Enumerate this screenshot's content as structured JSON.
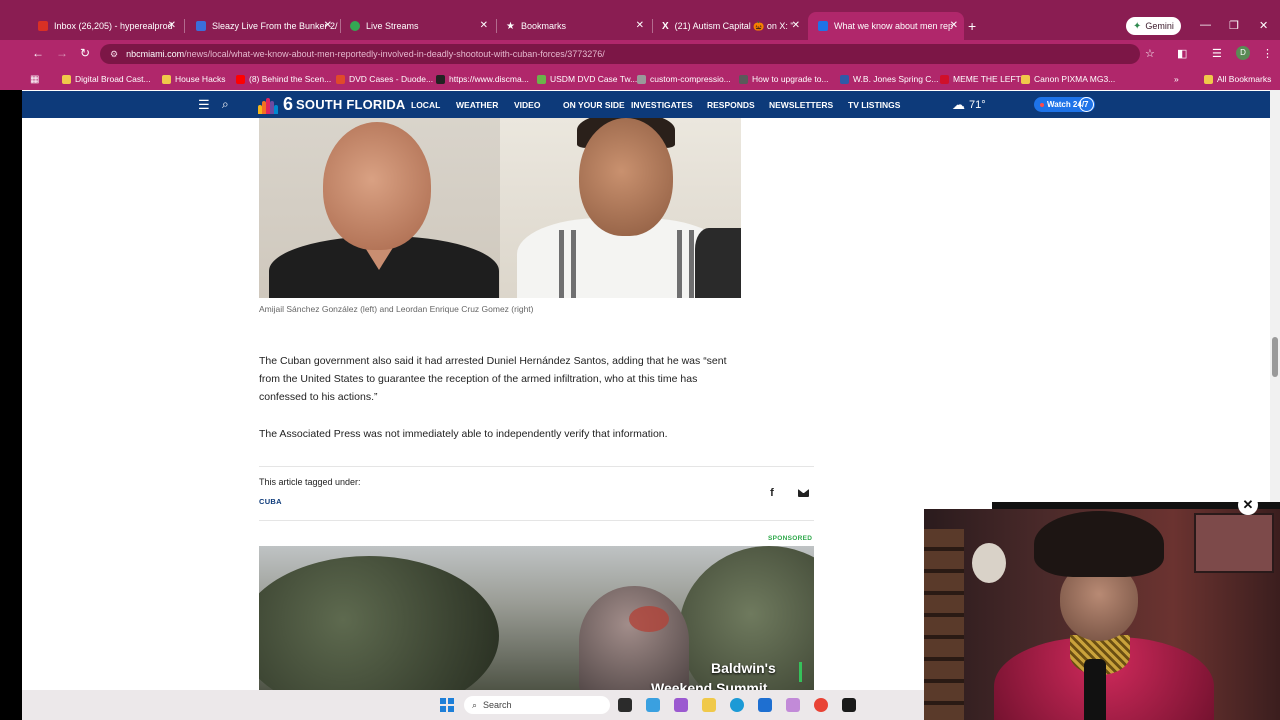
{
  "browser": {
    "tabs": [
      {
        "label": "Inbox (26,205) - hyperealprod",
        "color": "#d93025"
      },
      {
        "label": "Sleazy Live From the Bunker 2/",
        "color": "#3b6fd9"
      },
      {
        "label": "Live Streams",
        "color": "#34a853"
      },
      {
        "label": "Bookmarks",
        "color": "#ffffff"
      },
      {
        "label": "(21) Autism Capital 🎃 on X: \"",
        "color": "#000000"
      },
      {
        "label": "What we know about men rep",
        "color": "#1e73e8"
      }
    ],
    "new_tab": "+",
    "gemini": "Gemini",
    "url_host": "nbcmiami.com",
    "url_path": "/news/local/what-we-know-about-men-reportedly-involved-in-deadly-shootout-with-cuban-forces/3773276/",
    "profile_initial": "D",
    "bookmarks": [
      {
        "label": "Digital Broad Cast...",
        "color": "#f0c94a"
      },
      {
        "label": "House Hacks",
        "color": "#f0c94a"
      },
      {
        "label": "(8) Behind the Scen...",
        "color": "#ff0000"
      },
      {
        "label": "DVD Cases - Duode...",
        "color": "#e04a2a"
      },
      {
        "label": "https://www.discma...",
        "color": "#222222"
      },
      {
        "label": "USDM DVD Case Tw...",
        "color": "#6bb34a"
      },
      {
        "label": "custom-compressio...",
        "color": "#9a9a9a"
      },
      {
        "label": "How to upgrade to...",
        "color": "#5a5a5a"
      },
      {
        "label": "W.B. Jones Spring C...",
        "color": "#2f5aa8"
      },
      {
        "label": "MEME THE LEFT",
        "color": "#d0102a"
      },
      {
        "label": "Canon PIXMA MG3...",
        "color": "#f0c94a"
      }
    ],
    "all_bookmarks": "All Bookmarks"
  },
  "site": {
    "logo_number": "6",
    "logo_name": "SOUTH FLORIDA",
    "nav": [
      "LOCAL",
      "WEATHER",
      "VIDEO",
      "ON YOUR SIDE",
      "INVESTIGATES",
      "RESPONDS",
      "NEWSLETTERS",
      "TV LISTINGS"
    ],
    "temperature": "71°",
    "watch": "Watch 24/7"
  },
  "article": {
    "caption": "Amijail Sánchez González (left) and Leordan Enrique Cruz Gomez (right)",
    "paragraph1": "The Cuban government also said it had arrested Duniel Hernández Santos, adding that he was “sent from the United States to guarantee the reception of the armed infiltration, who at this time has confessed to his actions.”",
    "paragraph2": "The Associated Press was not immediately able to independently verify that information.",
    "tag_title": "This article tagged under:",
    "tag": "CUBA",
    "sponsored": "SPONSORED",
    "video_title": "Baldwin's",
    "video_title2": "Weekend Summit"
  },
  "taskbar": {
    "search": "Search"
  }
}
